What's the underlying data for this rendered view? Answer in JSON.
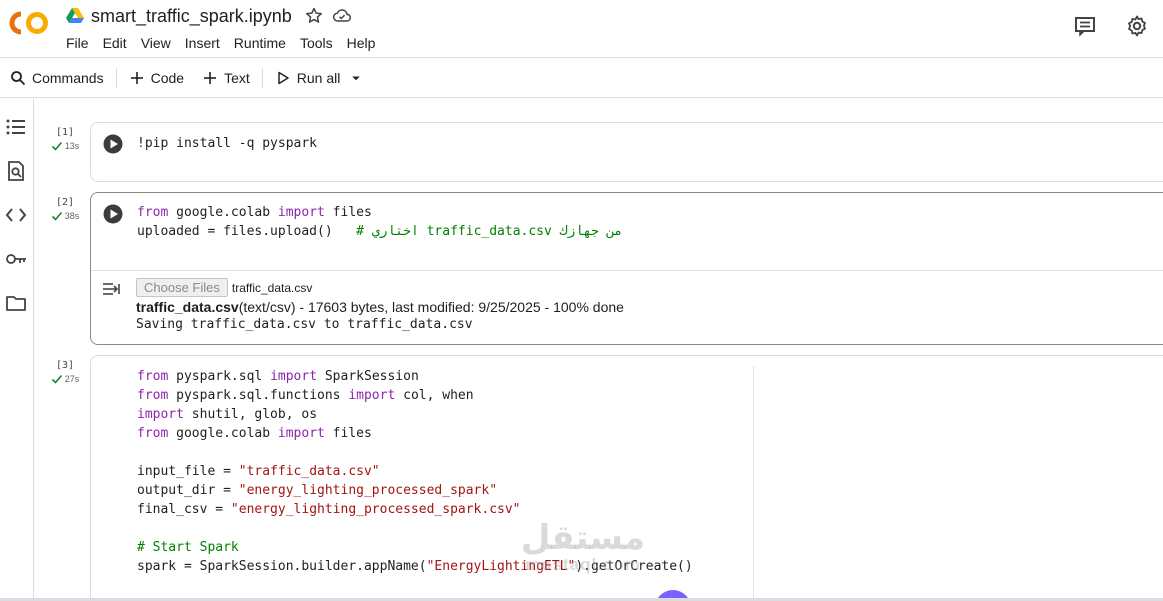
{
  "header": {
    "title": "smart_traffic_spark.ipynb",
    "menu": [
      "File",
      "Edit",
      "View",
      "Insert",
      "Runtime",
      "Tools",
      "Help"
    ]
  },
  "toolbar": {
    "commands": "Commands",
    "code": "Code",
    "text": "Text",
    "run_all": "Run all"
  },
  "cells": [
    {
      "exec": "[1]",
      "time": "13s",
      "lines": [
        [
          [
            "!pip install -q pyspark",
            ""
          ]
        ]
      ]
    },
    {
      "exec": "[2]",
      "time": "38s",
      "lines": [
        [
          [
            "from",
            "kw"
          ],
          [
            " google.colab ",
            ""
          ],
          [
            "import",
            "kw"
          ],
          [
            " files",
            ""
          ]
        ],
        [
          [
            "uploaded = files.upload()   ",
            ""
          ],
          [
            "# اختاري traffic_data.csv من جهازك",
            "cmt"
          ]
        ]
      ],
      "output": {
        "choose_files": "Choose Files",
        "file_chosen": "traffic_data.csv",
        "file_name": "traffic_data.csv",
        "file_info": "(text/csv) - 17603 bytes, last modified: 9/25/2025 - 100% done",
        "saving": "Saving traffic_data.csv to traffic_data.csv"
      }
    },
    {
      "exec": "[3]",
      "time": "27s",
      "lines": [
        [
          [
            "from",
            "kw"
          ],
          [
            " pyspark.sql ",
            ""
          ],
          [
            "import",
            "kw"
          ],
          [
            " SparkSession",
            ""
          ]
        ],
        [
          [
            "from",
            "kw"
          ],
          [
            " pyspark.sql.functions ",
            ""
          ],
          [
            "import",
            "kw"
          ],
          [
            " col, when",
            ""
          ]
        ],
        [
          [
            "import",
            "kw"
          ],
          [
            " shutil, glob, os",
            ""
          ]
        ],
        [
          [
            "from",
            "kw"
          ],
          [
            " google.colab ",
            ""
          ],
          [
            "import",
            "kw"
          ],
          [
            " files",
            ""
          ]
        ],
        [
          [
            "",
            ""
          ]
        ],
        [
          [
            "input_file = ",
            ""
          ],
          [
            "\"traffic_data.csv\"",
            "str"
          ]
        ],
        [
          [
            "output_dir = ",
            ""
          ],
          [
            "\"energy_lighting_processed_spark\"",
            "str"
          ]
        ],
        [
          [
            "final_csv = ",
            ""
          ],
          [
            "\"energy_lighting_processed_spark.csv\"",
            "str"
          ]
        ],
        [
          [
            "",
            ""
          ]
        ],
        [
          [
            "# Start Spark",
            "cmt"
          ]
        ],
        [
          [
            "spark = SparkSession.builder.appName(",
            ""
          ],
          [
            "\"EnergyLightingETL\"",
            "str"
          ],
          [
            ").getOrCreate()",
            ""
          ]
        ]
      ]
    }
  ],
  "watermark": {
    "arabic": "مستقل",
    "latin": "mostaql.com"
  },
  "colors": {
    "keyword": "#8e24aa",
    "string": "#a31515",
    "comment": "#008000",
    "logo_orange": "#f9ab00",
    "logo_dark_orange": "#e8710a"
  }
}
